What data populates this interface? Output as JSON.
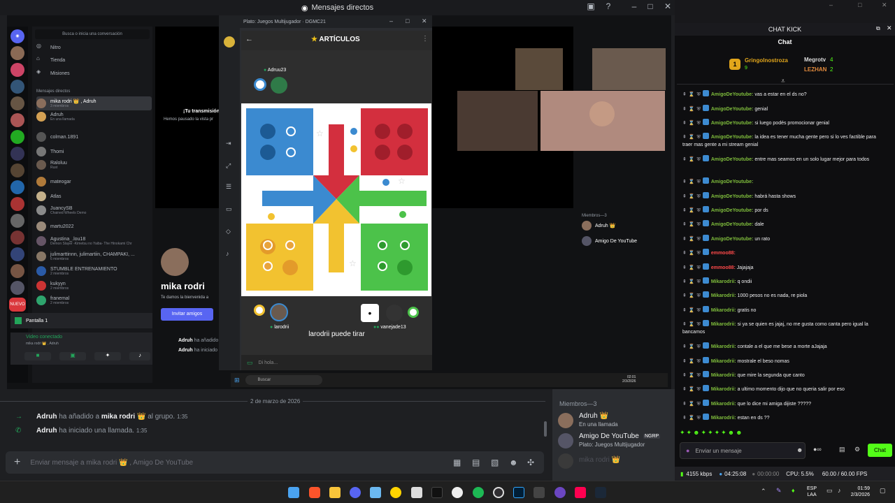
{
  "discord": {
    "title": "Mensajes directos",
    "search_placeholder": "Busca o inicia una conversación",
    "nav": [
      "Nitro",
      "Tienda",
      "Misiones"
    ],
    "dm_header": "Mensajes directos",
    "dms": [
      {
        "name": "mika rodri 👑 , Adruh",
        "sub": "3 miembros"
      },
      {
        "name": "Adruh",
        "sub": "En una llamada"
      },
      {
        "name": "colman.1891",
        "sub": ""
      },
      {
        "name": "Thomi",
        "sub": ""
      },
      {
        "name": "Raloluu",
        "sub": "Rust"
      },
      {
        "name": "mateogar",
        "sub": ""
      },
      {
        "name": "Atlas",
        "sub": ""
      },
      {
        "name": "JuancySB",
        "sub": "Chained Wheels Demo"
      },
      {
        "name": "martu2022",
        "sub": ""
      },
      {
        "name": "Agustina_.lou18",
        "sub": "Demon Slayer -Kimetsu no Yaiba- The Hinokami Chr"
      },
      {
        "name": "julimarttinnn, julimartiin, CHAMPAKI, ...",
        "sub": "6 miembros"
      },
      {
        "name": "STUMBLE ENTRENAMIENTO",
        "sub": "2 miembros"
      },
      {
        "name": "kukyyn",
        "sub": "2 miembros"
      },
      {
        "name": "franemal",
        "sub": "2 miembros"
      }
    ],
    "screen_share": "Pantalla 1",
    "voice_connected": "Video conectado",
    "voice_sub": "mika rodri 👑 , Adruh",
    "stream_msg_title": "¡Tu transmisión",
    "stream_msg_sub": "Hemos pausado la vista pr",
    "profile_name": "mika rodri",
    "profile_welcome": "Te damos la bienvenida a",
    "invite_label": "Invitar amigos",
    "members_header": "Miembros—3",
    "members": [
      {
        "name": "Adruh 👑",
        "sub": "En una llamada"
      },
      {
        "name": "Amigo De YouTube",
        "tag": "NGRP",
        "sub": "Plato: Juegos Multijugador"
      },
      {
        "name": "mika rodri 👑",
        "sub": ""
      }
    ],
    "date_divider": "2 de marzo de 2026",
    "events": [
      {
        "user": "Adruh",
        "text": "ha añadido a",
        "target": "mika rodri 👑",
        "tail": "al grupo.",
        "time": "1:35"
      },
      {
        "user": "Adruh",
        "text": "ha iniciado una llamada.",
        "target": "",
        "tail": "",
        "time": "1:35"
      }
    ],
    "input_placeholder": "Enviar mensaje a mika rodri 👑 , Amigo De YouTube"
  },
  "game": {
    "window_title": "Plato: Juegos Multijugador · DGMC21",
    "header_title": "ARTÍCULOS",
    "top_player": "Adruu23",
    "bottom_left_player": "larodrii",
    "bottom_right_player": "vanejade13",
    "status": "larodrii puede tirar",
    "chat_placeholder": "Di hola..."
  },
  "inner_taskbar": {
    "search": "Buscar",
    "time": "02:01",
    "date": "2/3/2026"
  },
  "kick": {
    "title": "CHAT KICK",
    "header": "Chat",
    "top_users": [
      {
        "name": "Gringolnostroza",
        "count": "9"
      },
      {
        "name": "Megrotv",
        "count": "4"
      },
      {
        "name": "LEZHAN",
        "count": "2"
      }
    ],
    "messages": [
      {
        "user": "AmigoDeYoutube",
        "text": "vas a estar en el ds no?",
        "color": "green"
      },
      {
        "user": "AmigoDeYoutube",
        "text": "genial",
        "color": "green"
      },
      {
        "user": "AmigoDeYoutube",
        "text": "si luego podés promocionar genial",
        "color": "green"
      },
      {
        "user": "AmigoDeYoutube",
        "text": "la idea es tener mucha gente pero si lo ves factible para traer mas gente a mi stream genial",
        "color": "green"
      },
      {
        "user": "AmigoDeYoutube",
        "text": "entre mas seamos en un solo lugar mejor para todos",
        "color": "green"
      },
      {
        "user": "AmigoDeYoutube",
        "text": "",
        "color": "green"
      },
      {
        "user": "AmigoDeYoutube",
        "text": "habrá hasta shows",
        "color": "green"
      },
      {
        "user": "AmigoDeYoutube",
        "text": "por ds",
        "color": "green"
      },
      {
        "user": "AmigoDeYoutube",
        "text": "dale",
        "color": "green"
      },
      {
        "user": "AmigoDeYoutube",
        "text": "un rato",
        "color": "green"
      },
      {
        "user": "emmoo88",
        "text": "",
        "color": "red"
      },
      {
        "user": "emmoo88",
        "text": "Jajajaja",
        "color": "red"
      },
      {
        "user": "Mikarodrii",
        "text": "q ondii",
        "color": "green"
      },
      {
        "user": "Mikarodrii",
        "text": "1000 pesos no es nada, re piola",
        "color": "green"
      },
      {
        "user": "Mikarodrii",
        "text": "gratis no",
        "color": "green"
      },
      {
        "user": "Mikarodrii",
        "text": "si ya se quien es jajaj, no me gusta como canta pero igual la bancamos",
        "color": "green"
      },
      {
        "user": "Mikarodrii",
        "text": "contale a el que me bese a morte aJajaja",
        "color": "green"
      },
      {
        "user": "Mikarodrii",
        "text": "mostrale el beso nomas",
        "color": "green"
      },
      {
        "user": "Mikarodrii",
        "text": "que mire la segunda que canto",
        "color": "green"
      },
      {
        "user": "Mikarodrii",
        "text": "a ultimo momento dijo que no queria salir por eso",
        "color": "green"
      },
      {
        "user": "Mikarodrii",
        "text": "que lo dice mi amiga dijiste ?????",
        "color": "green"
      },
      {
        "user": "Mikarodrii",
        "text": "estan en ds ??",
        "color": "green"
      }
    ],
    "input_placeholder": "Enviar un mensaje",
    "chat_button": "Chat",
    "status": {
      "bitrate": "4155 kbps",
      "time1": "04:25:08",
      "time2": "00:00:00",
      "cpu": "CPU: 5.5%",
      "fps": "60.00 / 60.00 FPS"
    }
  },
  "taskbar": {
    "lang": "ESP",
    "lang2": "LAA",
    "time": "01:59",
    "date": "2/3/2026"
  }
}
